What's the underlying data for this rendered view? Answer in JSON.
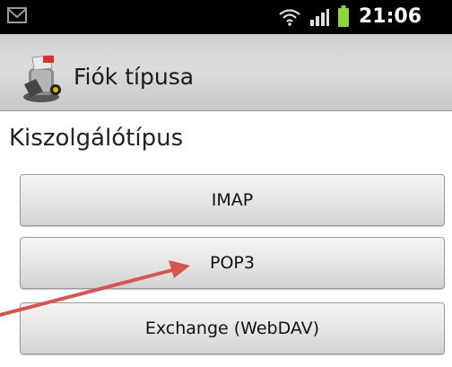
{
  "status_bar": {
    "time": "21:06",
    "icons": [
      "mail-icon",
      "wifi-icon",
      "signal-icon",
      "battery-icon"
    ]
  },
  "title_bar": {
    "app_icon": "email-app-icon",
    "title": "Fiók típusa"
  },
  "section": {
    "label": "Kiszolgálótípus"
  },
  "buttons": {
    "imap": "IMAP",
    "pop3": "POP3",
    "exchange": "Exchange (WebDAV)"
  },
  "annotation": {
    "arrow": "red-arrow-pointing-to-pop3",
    "color": "#d9534f"
  },
  "colors": {
    "status_bar_bg": "#000000",
    "title_bar_bg": "#d3d3d3",
    "battery": "#8cd43c"
  }
}
